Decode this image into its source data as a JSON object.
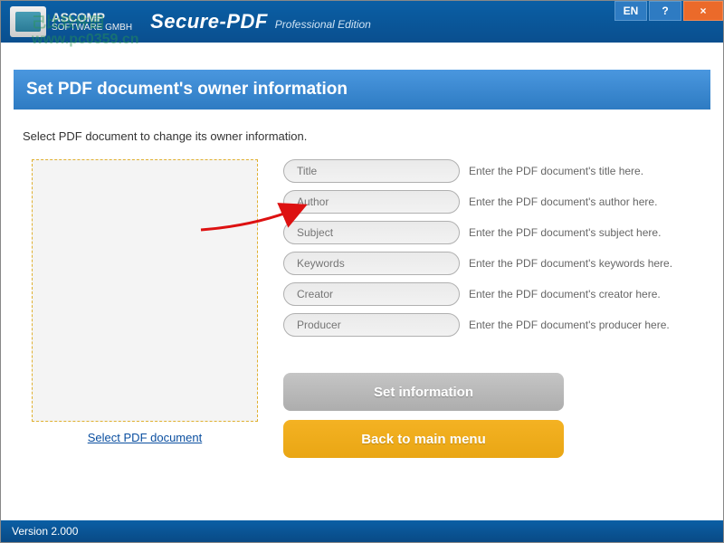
{
  "titlebar": {
    "brand_top": "ASCOMP",
    "brand_sub": "SOFTWARE GMBH",
    "app_name": "Secure-PDF",
    "edition": "Professional Edition",
    "lang": "EN",
    "help": "?",
    "close": "×"
  },
  "watermark_line1": "己比较件园",
  "watermark_line2": "www.pc0359.cn",
  "section_title": "Set PDF document's owner information",
  "instruction": "Select PDF document to change its owner information.",
  "select_link": "Select PDF document",
  "fields": [
    {
      "placeholder": "Title",
      "hint": "Enter the PDF document's title here."
    },
    {
      "placeholder": "Author",
      "hint": "Enter the PDF document's author here."
    },
    {
      "placeholder": "Subject",
      "hint": "Enter the PDF document's subject here."
    },
    {
      "placeholder": "Keywords",
      "hint": "Enter the PDF document's keywords here."
    },
    {
      "placeholder": "Creator",
      "hint": "Enter the PDF document's creator here."
    },
    {
      "placeholder": "Producer",
      "hint": "Enter the PDF document's producer here."
    }
  ],
  "actions": {
    "set_info": "Set information",
    "back": "Back to main menu"
  },
  "footer": {
    "version": "Version 2.000"
  }
}
